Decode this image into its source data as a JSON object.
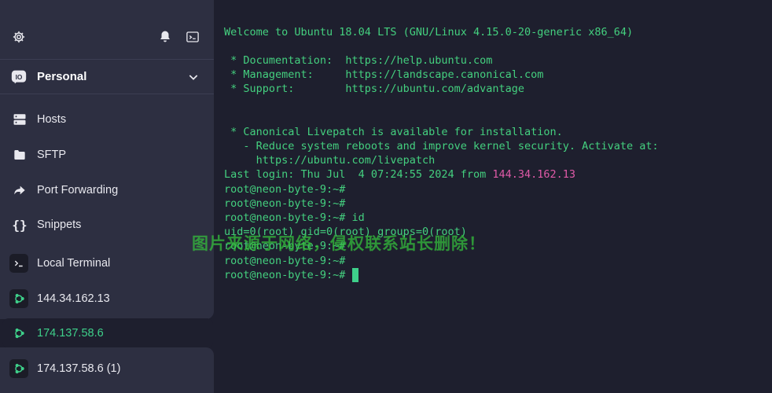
{
  "sidebar": {
    "vault_label": "Personal",
    "nav": [
      {
        "label": "Hosts",
        "icon": "hosts-icon"
      },
      {
        "label": "SFTP",
        "icon": "folder-icon"
      },
      {
        "label": "Port Forwarding",
        "icon": "forward-arrow-icon"
      },
      {
        "label": "Snippets",
        "icon": "curly-braces-icon"
      }
    ],
    "hosts": [
      {
        "label": "Local Terminal",
        "icon": "terminal-prompt-icon"
      },
      {
        "label": "144.34.162.13",
        "icon": "ubuntu-icon"
      },
      {
        "label": "174.137.58.6",
        "icon": "ubuntu-icon",
        "active": true
      },
      {
        "label": "174.137.58.6 (1)",
        "icon": "ubuntu-icon"
      }
    ]
  },
  "terminal": {
    "lines": [
      "Welcome to Ubuntu 18.04 LTS (GNU/Linux 4.15.0-20-generic x86_64)",
      "",
      " * Documentation:  https://help.ubuntu.com",
      " * Management:     https://landscape.canonical.com",
      " * Support:        https://ubuntu.com/advantage",
      "",
      "",
      " * Canonical Livepatch is available for installation.",
      "   - Reduce system reboots and improve kernel security. Activate at:",
      "     https://ubuntu.com/livepatch",
      "",
      "root@neon-byte-9:~#",
      "root@neon-byte-9:~#",
      "root@neon-byte-9:~# id",
      "uid=0(root) gid=0(root) groups=0(root)",
      "root@neon-byte-9:~#",
      "root@neon-byte-9:~#",
      "root@neon-byte-9:~# "
    ],
    "last_login_prefix": "Last login: Thu Jul  4 07:24:55 2024 from ",
    "last_login_ip": "144.34.162.13"
  },
  "watermark": "图片来源于网络，侵权联系站长删除！",
  "colors": {
    "terminal_text": "#44d07f",
    "ip_highlight": "#e05aa8",
    "sidebar_bg": "#2d2f41",
    "terminal_bg": "#1e1f2e",
    "active_accent": "#3ed08a"
  }
}
